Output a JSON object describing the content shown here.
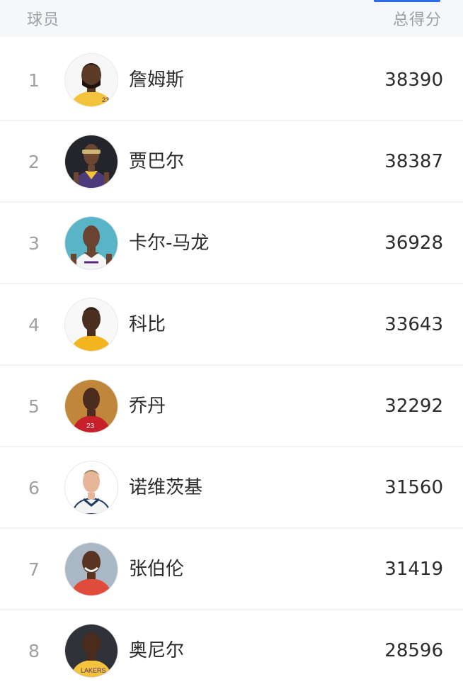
{
  "header": {
    "col_player": "球员",
    "col_points": "总得分"
  },
  "rows": [
    {
      "rank": "1",
      "name": "詹姆斯",
      "points": "38390"
    },
    {
      "rank": "2",
      "name": "贾巴尔",
      "points": "38387"
    },
    {
      "rank": "3",
      "name": "卡尔-马龙",
      "points": "36928"
    },
    {
      "rank": "4",
      "name": "科比",
      "points": "33643"
    },
    {
      "rank": "5",
      "name": "乔丹",
      "points": "32292"
    },
    {
      "rank": "6",
      "name": "诺维茨基",
      "points": "31560"
    },
    {
      "rank": "7",
      "name": "张伯伦",
      "points": "31419"
    },
    {
      "rank": "8",
      "name": "奥尼尔",
      "points": "28596"
    }
  ],
  "colors": {
    "accent": "#2f6bf2",
    "header_bg": "#f6f7f9",
    "muted_text": "#9aa0a8",
    "primary_text": "#2b2b2b"
  }
}
